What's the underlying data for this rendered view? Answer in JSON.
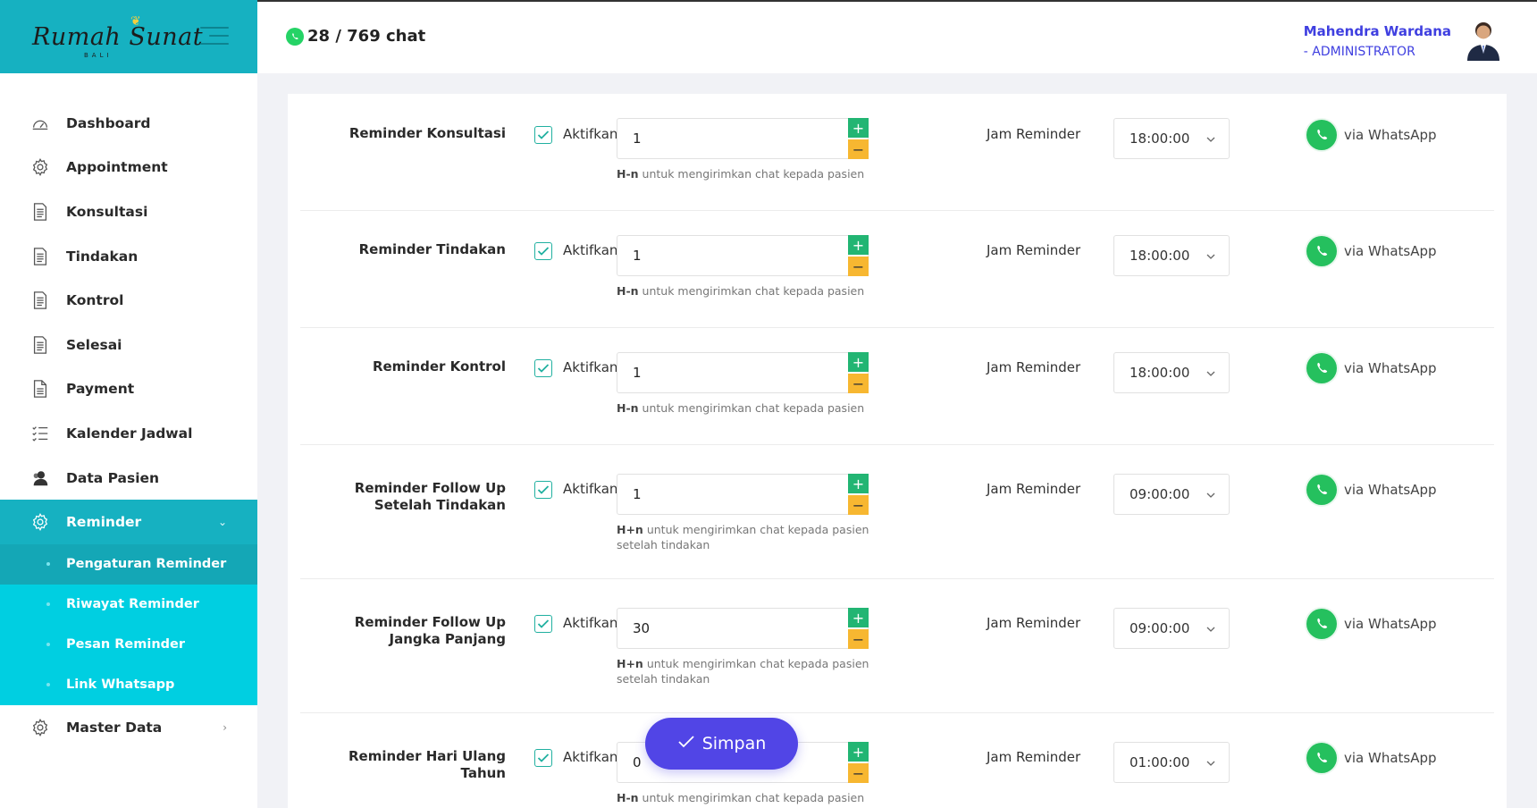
{
  "brand": {
    "logo_text": "Rumah Sunat",
    "logo_sub": "BALI"
  },
  "topbar": {
    "chat_count": "28 / 769 chat"
  },
  "user": {
    "name": "Mahendra Wardana",
    "role": "- ADMINISTRATOR"
  },
  "menu": {
    "items": [
      {
        "label": "Dashboard",
        "icon": "dashboard-icon"
      },
      {
        "label": "Appointment",
        "icon": "gear-icon"
      },
      {
        "label": "Konsultasi",
        "icon": "document-icon"
      },
      {
        "label": "Tindakan",
        "icon": "document-icon"
      },
      {
        "label": "Kontrol",
        "icon": "document-icon"
      },
      {
        "label": "Selesai",
        "icon": "document-icon"
      },
      {
        "label": "Payment",
        "icon": "file-icon"
      },
      {
        "label": "Kalender Jadwal",
        "icon": "checklist-icon"
      },
      {
        "label": "Data Pasien",
        "icon": "users-icon"
      }
    ],
    "reminder": {
      "label": "Reminder",
      "icon": "gear-icon"
    },
    "reminder_sub": [
      "Pengaturan Reminder",
      "Riwayat Reminder",
      "Pesan Reminder",
      "Link Whatsapp"
    ],
    "master": {
      "label": "Master Data",
      "icon": "gear-icon"
    }
  },
  "form": {
    "aktif_label": "Aktifkan",
    "jam_label": "Jam Reminder",
    "via_label": "via WhatsApp",
    "rows": [
      {
        "label_1": "Reminder Konsultasi",
        "label_2": "",
        "value": "1",
        "hint_prefix": "H-n",
        "hint_1": "untuk mengirimkan chat kepada pasien",
        "hint_2": "",
        "time": "18:00:00"
      },
      {
        "label_1": "Reminder Tindakan",
        "label_2": "",
        "value": "1",
        "hint_prefix": "H-n",
        "hint_1": "untuk mengirimkan chat kepada pasien",
        "hint_2": "",
        "time": "18:00:00"
      },
      {
        "label_1": "Reminder Kontrol",
        "label_2": "",
        "value": "1",
        "hint_prefix": "H-n",
        "hint_1": "untuk mengirimkan chat kepada pasien",
        "hint_2": "",
        "time": "18:00:00"
      },
      {
        "label_1": "Reminder Follow Up",
        "label_2": "Setelah Tindakan",
        "value": "1",
        "hint_prefix": "H+n",
        "hint_1": "untuk mengirimkan chat kepada pasien",
        "hint_2": "setelah tindakan",
        "time": "09:00:00"
      },
      {
        "label_1": "Reminder Follow Up",
        "label_2": "Jangka Panjang",
        "value": "30",
        "hint_prefix": "H+n",
        "hint_1": "untuk mengirimkan chat kepada pasien",
        "hint_2": "setelah tindakan",
        "time": "09:00:00"
      },
      {
        "label_1": "Reminder Hari Ulang",
        "label_2": "Tahun",
        "value": "0",
        "hint_prefix": "H-n",
        "hint_1": "untuk mengirimkan chat kepada pasien",
        "hint_2": "",
        "time": "01:00:00"
      }
    ]
  },
  "actions": {
    "save_label": "Simpan"
  },
  "colors": {
    "primary": "#16b1c1",
    "submenu": "#00cfe1",
    "button": "#5145e6",
    "plus": "#22b573",
    "minus": "#f7b731",
    "whatsapp": "#25d366"
  }
}
